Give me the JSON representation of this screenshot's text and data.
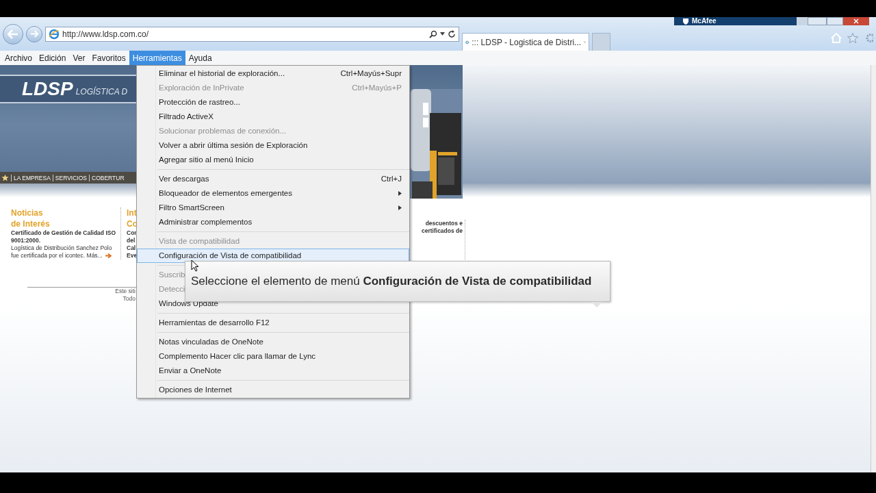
{
  "browser": {
    "brand": "McAfee",
    "url": "http://www.ldsp.com.co/",
    "tab_title": "::: LDSP - Logistica de Distri..."
  },
  "menubar": [
    {
      "label": "Archivo",
      "selected": false
    },
    {
      "label": "Edición",
      "selected": false
    },
    {
      "label": "Ver",
      "selected": false
    },
    {
      "label": "Favoritos",
      "selected": false
    },
    {
      "label": "Herramientas",
      "selected": true
    },
    {
      "label": "Ayuda",
      "selected": false
    }
  ],
  "menu": {
    "groups": [
      [
        {
          "label": "Eliminar el historial de exploración...",
          "shortcut": "Ctrl+Mayús+Supr",
          "disabled": false,
          "submenu": false,
          "selected": false
        },
        {
          "label": "Exploración de InPrivate",
          "shortcut": "Ctrl+Mayús+P",
          "disabled": true,
          "submenu": false,
          "selected": false
        },
        {
          "label": "Protección de rastreo...",
          "disabled": false,
          "submenu": false,
          "selected": false
        },
        {
          "label": "Filtrado ActiveX",
          "disabled": false,
          "submenu": false,
          "selected": false
        },
        {
          "label": "Solucionar problemas de conexión...",
          "disabled": true,
          "submenu": false,
          "selected": false
        },
        {
          "label": "Volver a abrir última sesión de Exploración",
          "disabled": false,
          "submenu": false,
          "selected": false
        },
        {
          "label": "Agregar sitio al menú Inicio",
          "disabled": false,
          "submenu": false,
          "selected": false
        }
      ],
      [
        {
          "label": "Ver descargas",
          "shortcut": "Ctrl+J",
          "disabled": false,
          "submenu": false,
          "selected": false
        },
        {
          "label": "Bloqueador de elementos emergentes",
          "disabled": false,
          "submenu": true,
          "selected": false
        },
        {
          "label": "Filtro SmartScreen",
          "disabled": false,
          "submenu": true,
          "selected": false
        },
        {
          "label": "Administrar complementos",
          "disabled": false,
          "submenu": false,
          "selected": false
        }
      ],
      [
        {
          "label": "Vista de compatibilidad",
          "disabled": true,
          "submenu": false,
          "selected": false
        },
        {
          "label": "Configuración de Vista de compatibilidad",
          "disabled": false,
          "submenu": false,
          "selected": true
        }
      ],
      [
        {
          "label": "Suscrib",
          "disabled": true,
          "submenu": false,
          "selected": false
        },
        {
          "label": "Detecci",
          "disabled": true,
          "submenu": false,
          "selected": false
        },
        {
          "label": "Windows Update",
          "disabled": false,
          "submenu": false,
          "selected": false
        }
      ],
      [
        {
          "label": "Herramientas de desarrollo F12",
          "disabled": false,
          "submenu": false,
          "selected": false
        }
      ],
      [
        {
          "label": "Notas vinculadas de OneNote",
          "disabled": false,
          "submenu": false,
          "selected": false
        },
        {
          "label": "Complemento Hacer clic para llamar de Lync",
          "disabled": false,
          "submenu": false,
          "selected": false
        },
        {
          "label": "Enviar a OneNote",
          "disabled": false,
          "submenu": false,
          "selected": false
        }
      ],
      [
        {
          "label": "Opciones de Internet",
          "disabled": false,
          "submenu": false,
          "selected": false
        }
      ]
    ]
  },
  "tooltip": "Seleccione el elemento de menú **Configuración de Vista de compatibilidad**",
  "page": {
    "logo": "LDSP",
    "tagline": "LOGÍSTICA D",
    "nav": [
      "LA EMPRESA",
      "SERVICIOS",
      "COBERTUR"
    ],
    "news": {
      "title": [
        "Noticias",
        "de Interés"
      ],
      "lead": "Certificado de Gestión de Calidad ISO 9001:2000.",
      "body": "Logística de Distribución Sanchez Polo fue certificada por el icontec. Más..."
    },
    "column_2": {
      "title": [
        "Int",
        "Co"
      ],
      "lines": [
        "Con",
        "del",
        "Cal",
        "Eve"
      ]
    },
    "column_3": {
      "lines": [
        "descuentos e",
        "certificados de"
      ]
    },
    "footer": [
      "Este siti",
      "Todo"
    ]
  }
}
